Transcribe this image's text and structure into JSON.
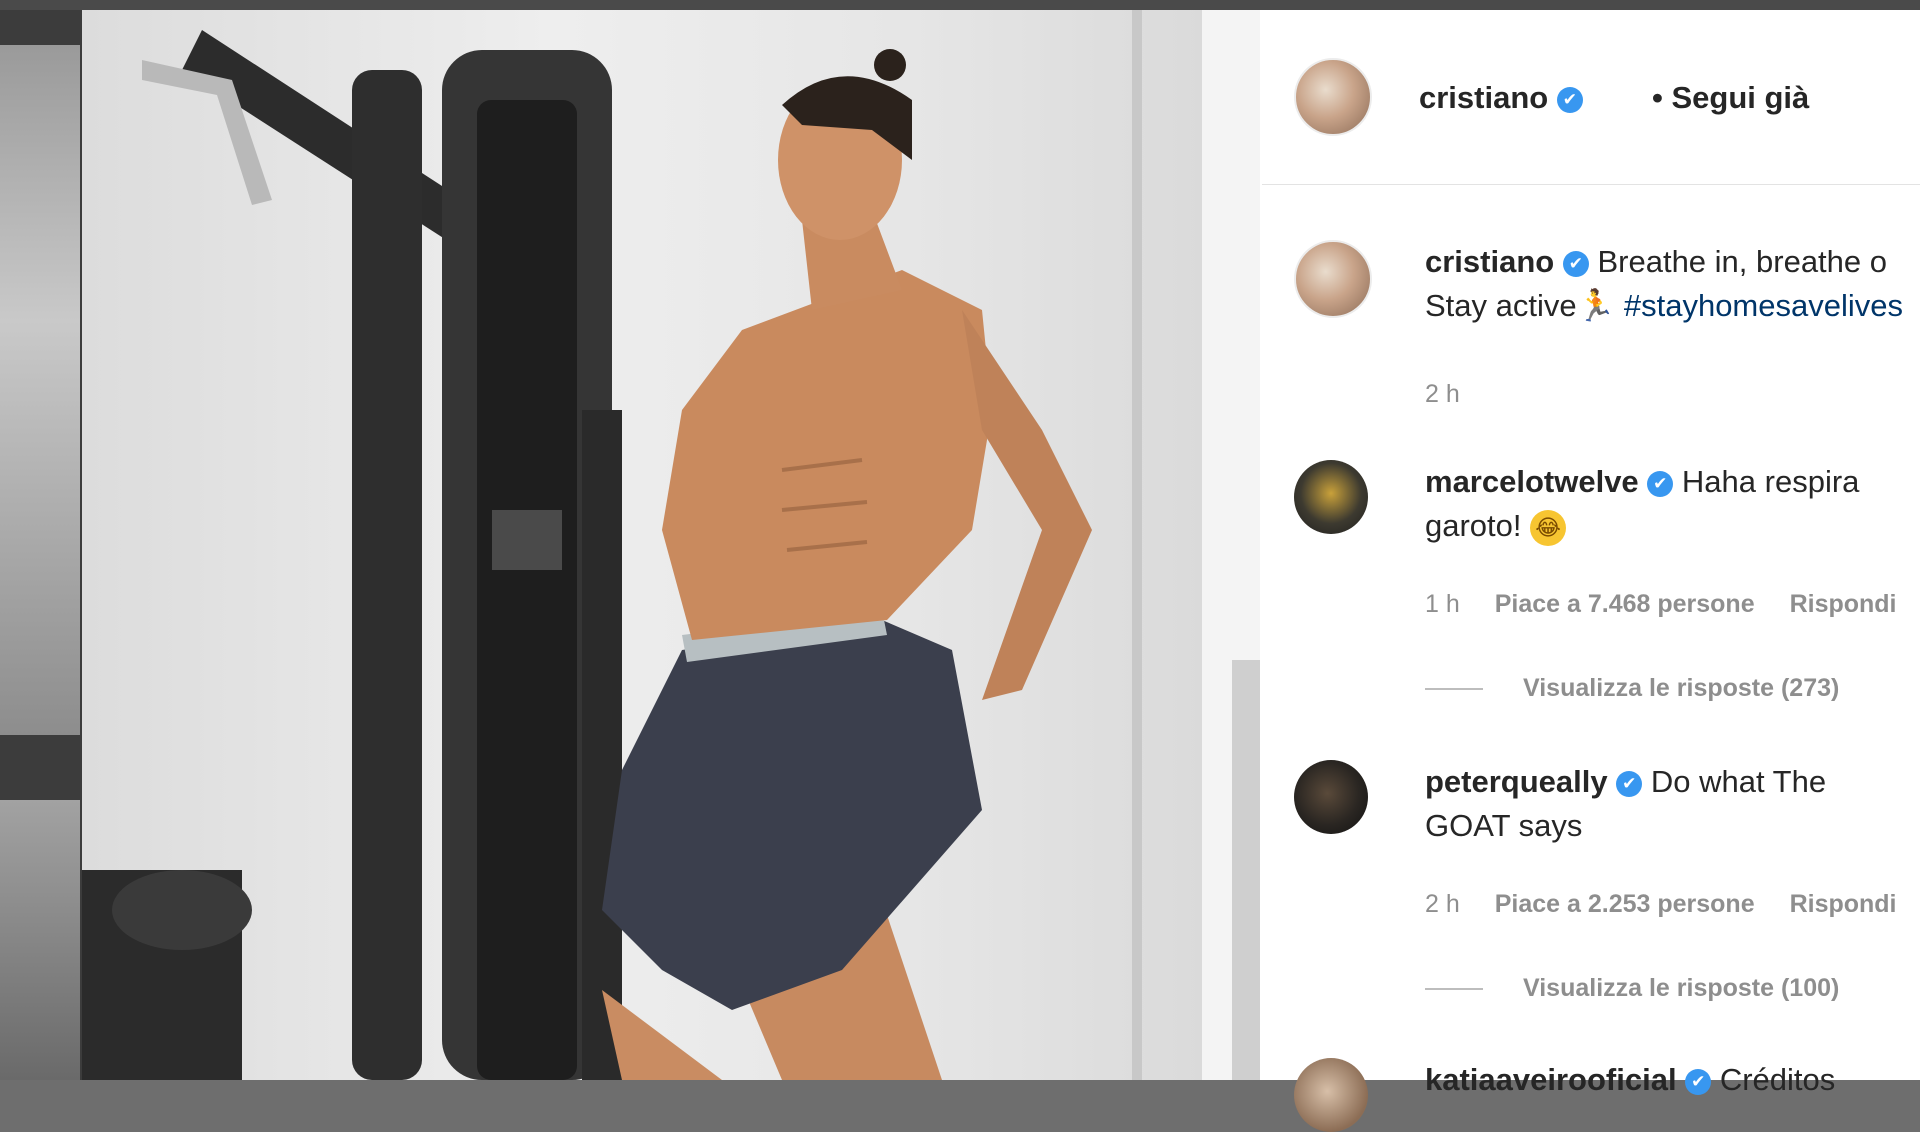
{
  "post": {
    "author": "cristiano",
    "follow_status": "• Segui già",
    "caption_line1": "Breathe in, breathe o",
    "caption_line2_prefix": "Stay active",
    "caption_hashtag": "#stayhomesavelives",
    "caption_time": "2 h",
    "verified_mark": "✔",
    "runner_icon": "🏃"
  },
  "comments": [
    {
      "username": "marcelotwelve",
      "text_line1": "Haha respira",
      "text_line2": "garoto!",
      "emoji": "😂",
      "time": "1 h",
      "likes": "Piace a 7.468 persone",
      "reply": "Rispondi",
      "view_replies": "Visualizza le risposte (273)"
    },
    {
      "username": "peterqueally",
      "text_line1": "Do what The",
      "text_line2": "GOAT says",
      "time": "2 h",
      "likes": "Piace a 2.253 persone",
      "reply": "Rispondi",
      "view_replies": "Visualizza le risposte (100)"
    },
    {
      "username": "katiaaveirooficial",
      "text_line1": "Créditos"
    }
  ],
  "colors": {
    "verified": "#3897f0",
    "hashtag": "#003569",
    "meta_text": "#8e8e8e",
    "text": "#262626"
  }
}
